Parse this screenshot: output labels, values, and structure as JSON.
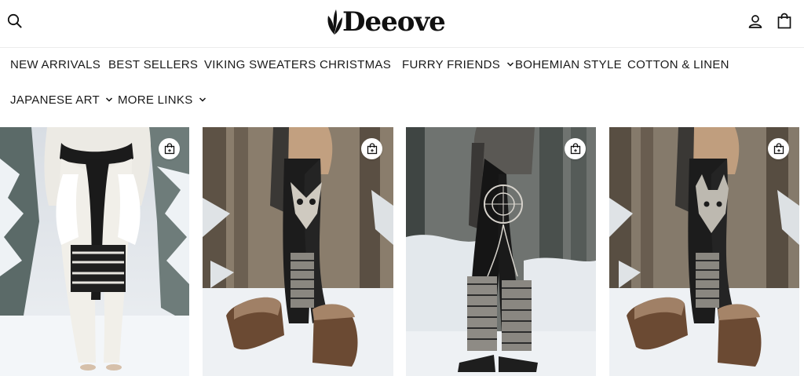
{
  "header": {
    "logo_text": "Deeove",
    "icons": {
      "search": "search-icon",
      "account": "user-icon",
      "cart": "shopping-bag-icon"
    }
  },
  "nav": {
    "items": [
      {
        "label": "NEW ARRIVALS",
        "has_dropdown": false
      },
      {
        "label": "BEST SELLERS",
        "has_dropdown": false
      },
      {
        "label": "VIKING SWEATERS",
        "has_dropdown": false
      },
      {
        "label": "CHRISTMAS",
        "has_dropdown": false
      },
      {
        "label": "FURRY FRIENDS",
        "has_dropdown": true
      },
      {
        "label": "BOHEMIAN STYLE",
        "has_dropdown": false
      },
      {
        "label": "COTTON & LINEN",
        "has_dropdown": false
      },
      {
        "label": "JAPANESE ART",
        "has_dropdown": true
      },
      {
        "label": "MORE LINKS",
        "has_dropdown": true
      }
    ]
  },
  "products": [
    {
      "image": "white knit wing leggings in snowy forest",
      "icon": "quick-add-bag-icon"
    },
    {
      "image": "black owl print leggings with fur boots",
      "icon": "quick-add-bag-icon"
    },
    {
      "image": "black dreamcatcher leggings with knit leg warmers",
      "icon": "quick-add-bag-icon"
    },
    {
      "image": "black wolf print leggings with fur boots",
      "icon": "quick-add-bag-icon"
    }
  ],
  "colors": {
    "text": "#111111",
    "background": "#ffffff",
    "divider": "#ececec"
  }
}
